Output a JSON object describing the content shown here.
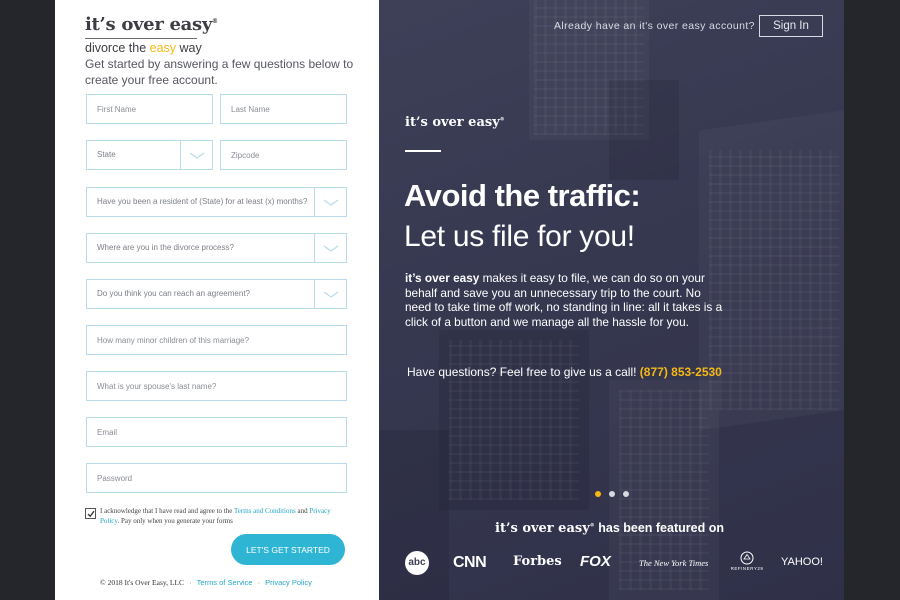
{
  "brand": {
    "logo_text": "it’s over easy",
    "logo_mark": "®",
    "tagline_before": "divorce the ",
    "tagline_highlight": "easy",
    "tagline_after": " way"
  },
  "form": {
    "intro": "Get started by answering a few questions below to create your free account.",
    "first_name_placeholder": "First Name",
    "last_name_placeholder": "Last Name",
    "state_placeholder": "State",
    "zipcode_placeholder": "Zipcode",
    "residency_question": "Have you been a resident of (State) for at least (x) months?",
    "process_question": "Where are you in the divorce process?",
    "agreement_question": "Do you think you can reach an agreement?",
    "children_placeholder": "How many minor children of this marriage?",
    "spouse_placeholder": "What is your spouse's last name?",
    "email_placeholder": "Email",
    "password_placeholder": "Password",
    "terms_before": "I acknowledge that I have read and agree to the ",
    "terms_link": "Terms and Conditions",
    "terms_and": " and ",
    "privacy_link": "Privacy Policy",
    "terms_after": ". Pay only when you generate your forms",
    "terms_checked": true,
    "submit_label": "LET'S GET STARTED"
  },
  "footer": {
    "copyright": "© 2018 It's Over Easy, LLC",
    "terms_link": "Terms of Service",
    "privacy_link": "Privacy Policy",
    "separator": "·"
  },
  "header": {
    "account_question": "Already have an it's over easy account?",
    "signin_label": "Sign In"
  },
  "hero": {
    "logo_text": "it’s over easy",
    "heading": "Avoid the traffic:",
    "subheading": "Let us file for you!",
    "body_brand": "it’s over easy",
    "body": " makes it easy to file, we can do so on your behalf and save you an unnecessary trip to the court. No need to take time off work, no standing in line: all it takes is a click of a button and we manage all the hassle for you.",
    "phone_prompt": "Have questions? Feel free to give  us a call! ",
    "phone_number": "(877) 853-2530",
    "carousel_count": 3,
    "carousel_active": 0
  },
  "featured": {
    "brand": "it’s over easy",
    "text": " has been featured on",
    "outlets": [
      "abc",
      "CNN",
      "Forbes",
      "FOX",
      "The New York Times",
      "REFINERY29",
      "YAHOO!"
    ]
  },
  "colors": {
    "accent_blue": "#2eb5d3",
    "accent_yellow": "#f5b914",
    "field_border": "#b9dced"
  }
}
